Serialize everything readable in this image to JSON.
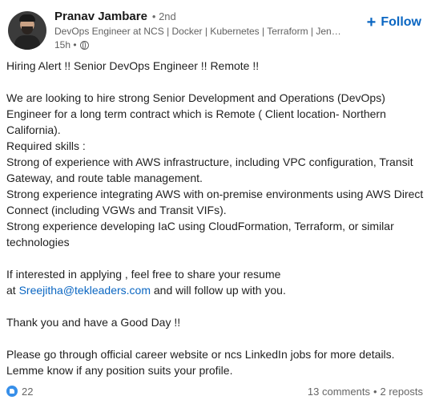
{
  "author": {
    "name": "Pranav Jambare",
    "degree": "• 2nd",
    "headline": "DevOps Engineer at NCS | Docker | Kubernetes | Terraform | Jenkins | Li...",
    "time": "15h •"
  },
  "follow": {
    "label": "Follow",
    "plus": "+"
  },
  "post": {
    "line1": "Hiring Alert !! Senior DevOps Engineer !! Remote !!",
    "p2": "We are looking to hire strong Senior Development and Operations (DevOps) Engineer for a long term contract which is Remote ( Client location- Northern California).",
    "req_title": "Required skills :",
    "req1": "Strong of experience with AWS infrastructure, including VPC configuration, Transit Gateway, and route table management.",
    "req2": "Strong experience integrating AWS with on-premise environments using AWS Direct Connect (including VGWs and Transit VIFs).",
    "req3": "Strong experience developing IaC using CloudFormation, Terraform, or similar technologies",
    "apply1": "If interested in applying , feel free to share your resume",
    "apply_at": "at ",
    "email": "Sreejitha@tekleaders.com",
    "apply_tail": " and will follow up with you.",
    "thanks": "Thank you and have a Good Day !!",
    "closing": "Please go through official career website or ncs LinkedIn jobs for more details. Lemme know if any position suits your profile."
  },
  "stats": {
    "reactions": "22",
    "comments": "13 comments",
    "sep": "•",
    "reposts": "2 reposts"
  }
}
